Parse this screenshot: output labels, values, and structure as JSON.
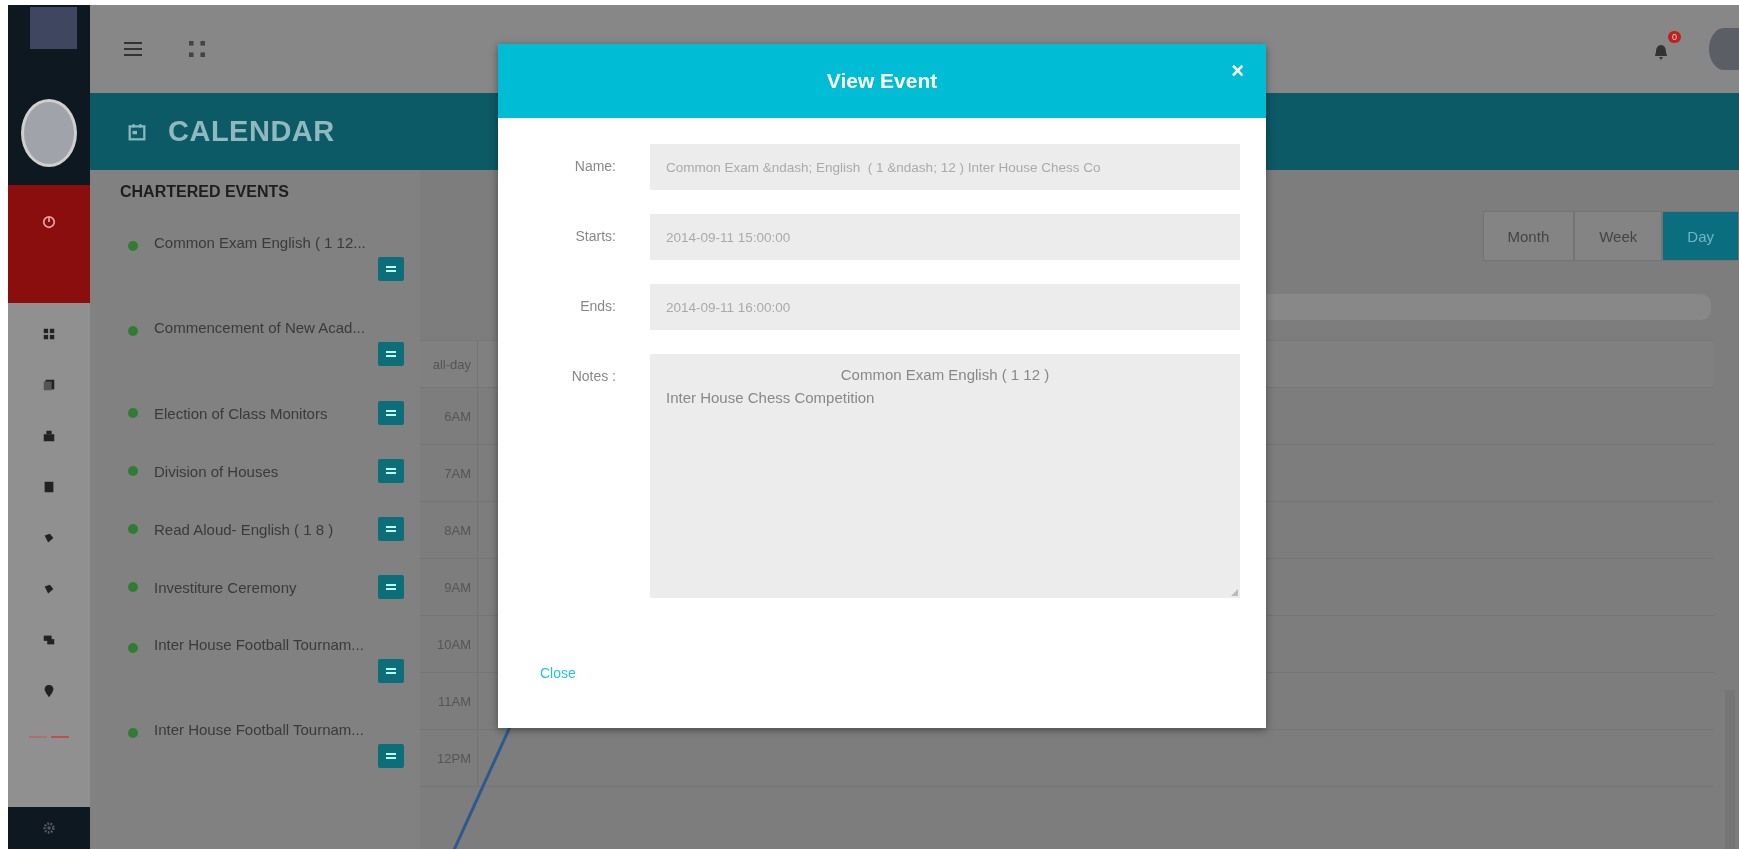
{
  "header": {
    "notification_count": "0"
  },
  "page_title": "CALENDAR",
  "events_panel": {
    "title": "CHARTERED EVENTS",
    "events": [
      {
        "name": "Common Exam English ( 1 12...",
        "color": "#2e7d32",
        "wrap": true
      },
      {
        "name": "Commencement of New Acad...",
        "color": "#2e7d32",
        "wrap": true
      },
      {
        "name": "Election of Class Monitors",
        "color": "#2e7d32",
        "wrap": false
      },
      {
        "name": "Division of Houses",
        "color": "#2e7d32",
        "wrap": false
      },
      {
        "name": "Read Aloud- English ( 1 8 )",
        "color": "#2e7d32",
        "wrap": false
      },
      {
        "name": "Investiture Ceremony",
        "color": "#2e7d32",
        "wrap": false
      },
      {
        "name": "Inter House Football Tournam...",
        "color": "#2e7d32",
        "wrap": true
      },
      {
        "name": "Inter House Football Tournam...",
        "color": "#2e7d32",
        "wrap": true
      }
    ]
  },
  "calendar": {
    "views": [
      {
        "label": "Month",
        "selected": false
      },
      {
        "label": "Week",
        "selected": false
      },
      {
        "label": "Day",
        "selected": true
      }
    ],
    "all_day_label": "all-day",
    "times": [
      "6AM",
      "7AM",
      "8AM",
      "9AM",
      "10AM",
      "11AM",
      "12PM"
    ]
  },
  "modal": {
    "title": "View Event",
    "close_symbol": "×",
    "fields": [
      {
        "label": "Name:",
        "kind": "input",
        "value": "Common Exam &ndash; English  ( 1 &ndash; 12 ) Inter House Chess Co"
      },
      {
        "label": "Starts:",
        "kind": "input",
        "value": "2014-09-11 15:00:00"
      },
      {
        "label": "Ends:",
        "kind": "input",
        "value": "2014-09-11 16:00:00"
      },
      {
        "label": "Notes :",
        "kind": "textarea",
        "lines": [
          "Common Exam  English  ( 1  12 )",
          "Inter House Chess Competition"
        ]
      }
    ],
    "close_link": "Close"
  }
}
